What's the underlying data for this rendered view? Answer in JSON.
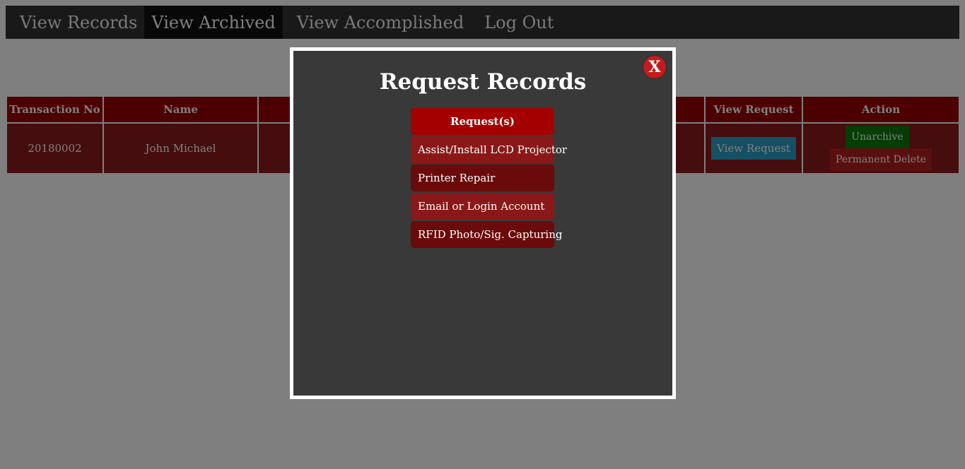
{
  "nav": {
    "items": [
      {
        "label": "View Records"
      },
      {
        "label": "View Archived"
      },
      {
        "label": "View Accomplished"
      },
      {
        "label": "Log Out"
      }
    ]
  },
  "table": {
    "headers": [
      "Transaction No",
      "Name",
      "",
      "",
      "",
      "",
      "View Request",
      "Action"
    ],
    "rows": [
      {
        "transaction_no": "20180002",
        "name": "John Michael",
        "view_request_label": "View Request",
        "unarchive_label": "Unarchive",
        "delete_label": "Permanent Delete"
      }
    ]
  },
  "modal": {
    "title": "Request Records",
    "close_label": "X",
    "list_header": "Request(s)",
    "requests": [
      {
        "label": "Assist/Install LCD Projector"
      },
      {
        "label": "Printer Repair"
      },
      {
        "label": "Email or Login Account"
      },
      {
        "label": "RFID Photo/Sig. Capturing"
      }
    ]
  },
  "colors": {
    "nav_bg": "#333333",
    "nav_active_bg": "#111111",
    "table_header_bg": "#9b0000",
    "table_row_bg": "#8b1a1a",
    "view_button": "#2aa1c9",
    "unarchive_button": "#0b7a0b",
    "delete_button": "#b51f1f",
    "modal_bg": "#393939",
    "close_button": "#c41b1b"
  }
}
